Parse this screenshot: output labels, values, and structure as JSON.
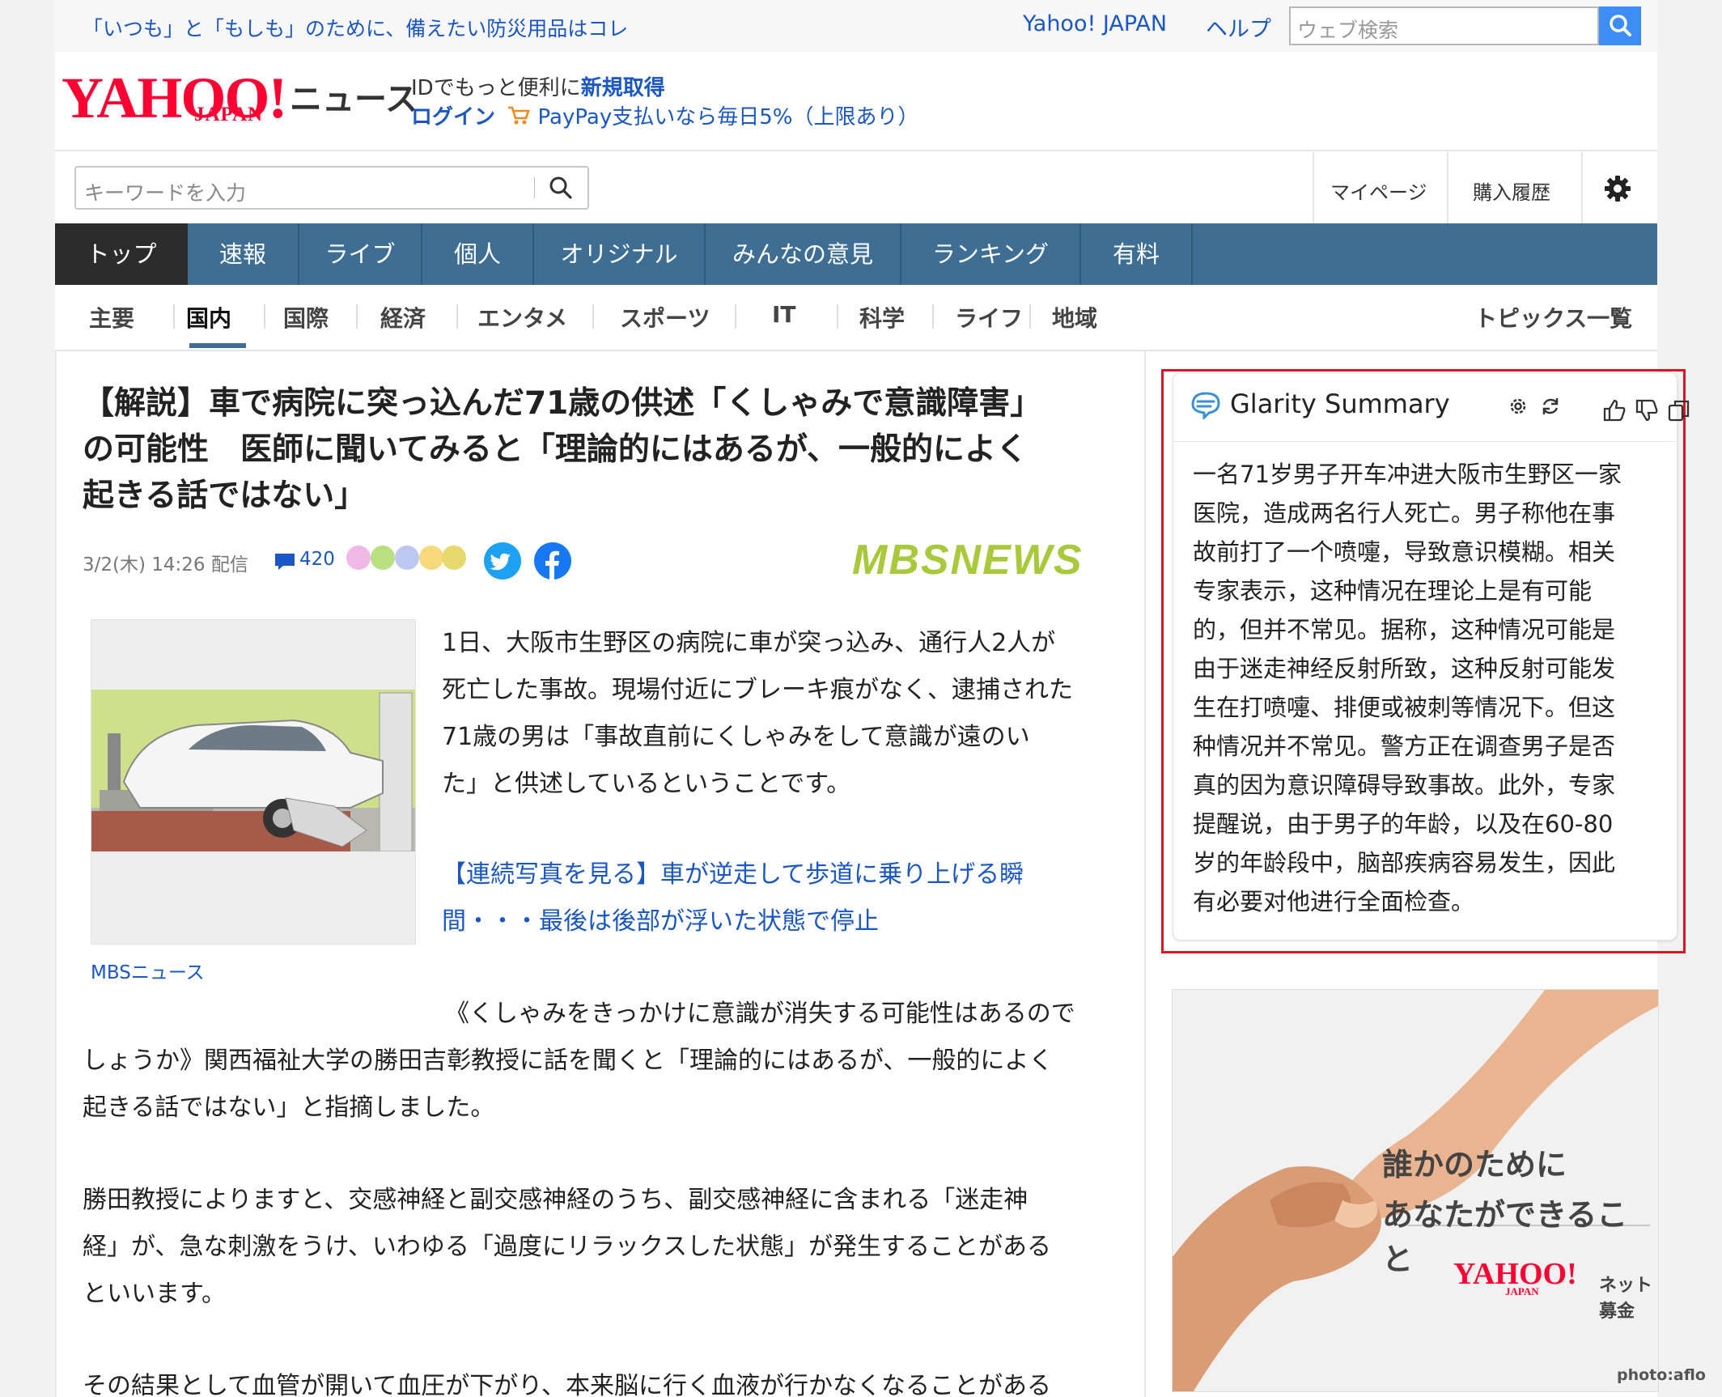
{
  "topbar": {
    "promo": "「いつも」と「もしも」のために、備えたい防災用品はコレ",
    "yahoo_japan_link": "Yahoo! JAPAN",
    "help_link": "ヘルプ",
    "web_search_placeholder": "ウェブ検索"
  },
  "brand": {
    "logo_main": "YAHOO!",
    "logo_sub": "JAPAN",
    "section": "ニュース"
  },
  "account": {
    "id_prefix": "IDでもっと便利に",
    "signup": "新規取得",
    "login": "ログイン",
    "paypay_promo": "PayPay支払いなら毎日5%（上限あり）"
  },
  "search": {
    "placeholder": "キーワードを入力"
  },
  "utility": {
    "mypage": "マイページ",
    "purchase_history": "購入履歴"
  },
  "main_nav": {
    "items": [
      "トップ",
      "速報",
      "ライブ",
      "個人",
      "オリジナル",
      "みんなの意見",
      "ランキング",
      "有料"
    ],
    "active": "トップ"
  },
  "sub_nav": {
    "items": [
      "主要",
      "国内",
      "国際",
      "経済",
      "エンタメ",
      "スポーツ",
      "IT",
      "科学",
      "ライフ",
      "地域"
    ],
    "active": "国内",
    "topics_link": "トピックス一覧"
  },
  "article": {
    "title_lines": [
      "【解説】車で病院に突っ込んだ71歳の供述「くしゃみで意識障害」",
      "の可能性　医師に聞いてみると「理論的にはあるが、一般的によく",
      "起きる話ではない」"
    ],
    "date": "3/2(木) 14:26 配信",
    "comment_count": "420",
    "source_logo": "MBSNEWS",
    "photo_caption": "MBSニュース",
    "lead_lines": [
      "1日、大阪市生野区の病院に車が突っ込み、通行人2人が",
      "死亡した事故。現場付近にブレーキ痕がなく、逮捕された",
      "71歳の男は「事故直前にくしゃみをして意識が遠のい",
      "た」と供述しているということです。"
    ],
    "lead_link_lines": [
      "【連続写真を見る】車が逆走して歩道に乗り上げる瞬",
      "間・・・最後は後部が浮いた状態で停止"
    ],
    "para1_lines": [
      "《くしゃみをきっかけに意識が消失する可能性はあるので",
      "しょうか》関西福祉大学の勝田吉彰教授に話を聞くと「理論的にはあるが、一般的によく",
      "起きる話ではない」と指摘しました。"
    ],
    "para2_lines": [
      "勝田教授によりますと、交感神経と副交感神経のうち、副交感神経に含まれる「迷走神",
      "経」が、急な刺激をうけ、いわゆる「過度にリラックスした状態」が発生することがある",
      "といいます。"
    ],
    "para3_partial": "その結果として血管が開いて血圧が下がり、本来脳に行く血液が行かなくなることがある"
  },
  "glarity": {
    "title": "Glarity Summary",
    "summary_lines": [
      "一名71岁男子开车冲进大阪市生野区一家",
      "医院，造成两名行人死亡。男子称他在事",
      "故前打了一个喷嚏，导致意识模糊。相关",
      "专家表示，这种情况在理论上是有可能",
      "的，但并不常见。据称，这种情况可能是",
      "由于迷走神经反射所致，这种反射可能发",
      "生在打喷嚏、排便或被刺等情况下。但这",
      "种情况并不常见。警方正在调查男子是否",
      "真的因为意识障碍导致事故。此外，专家",
      "提醒说，由于男子的年龄，以及在60-80",
      "岁的年龄段中，脑部疾病容易发生，因此",
      "有必要对他进行全面检查。"
    ]
  },
  "ad": {
    "line1": "誰かのために",
    "line2": "あなたができること",
    "brand_main": "YAHOO!",
    "brand_sub": "JAPAN",
    "brand_service": "ネット募金",
    "credit": "photo:aflo"
  },
  "colors": {
    "link_blue": "#1a56c4",
    "nav_bar": "#3e6e93",
    "nav_active": "#2c2c2c",
    "yahoo_red": "#ff0033",
    "highlight_red": "#e0131e",
    "mbs_green": "#a8c93a"
  }
}
